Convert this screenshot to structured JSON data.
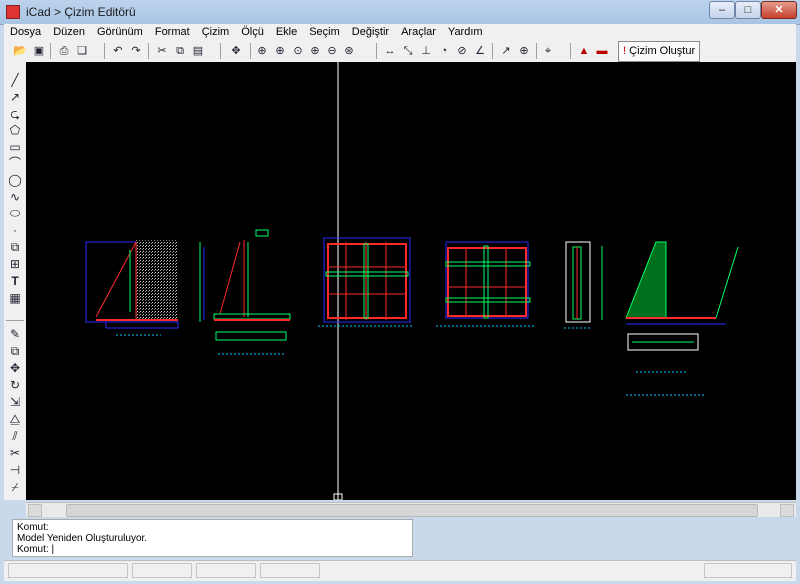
{
  "window": {
    "title": "iCad > Çizim Editörü",
    "min_label": "–",
    "max_label": "□",
    "close_label": "✕"
  },
  "menu": [
    "Dosya",
    "Düzen",
    "Görünüm",
    "Format",
    "Çizim",
    "Ölçü",
    "Ekle",
    "Seçim",
    "Değiştir",
    "Araçlar",
    "Yardım"
  ],
  "toolbar": {
    "cizim_olustur_label": "Çizim Oluştur",
    "icons": [
      "open-icon",
      "save-icon",
      "print-preview-icon",
      "paste-icon",
      "undo-icon",
      "redo-icon",
      "cut-icon",
      "copy-icon",
      "paste-special-icon",
      "pan-icon",
      "zoom-window-icon",
      "zoom-realtime-icon",
      "zoom-extents-icon",
      "zoom-in-icon",
      "zoom-out-icon",
      "zoom-all-icon",
      "dimension-linear-icon",
      "dimension-aligned-icon",
      "dimension-ordinate-icon",
      "dimension-radius-icon",
      "dimension-diameter-icon",
      "dimension-angle-icon",
      "leader-icon",
      "center-mark-icon",
      "snap-icon",
      "layer-icon",
      "hatch-icon"
    ]
  },
  "left_tools": [
    "line-icon",
    "ray-icon",
    "polyline-icon",
    "polygon-icon",
    "rectangle-icon",
    "arc-icon",
    "circle-icon",
    "spline-icon",
    "ellipse-icon",
    "point-icon",
    "block-icon",
    "insert-icon",
    "text-icon",
    "hatch-tool-icon",
    "erase-icon",
    "copy-tool-icon",
    "move-icon",
    "rotate-icon",
    "scale-icon",
    "mirror-icon",
    "offset-icon",
    "trim-icon",
    "extend-icon",
    "break-icon"
  ],
  "command": {
    "line1": "Komut:",
    "line2": " Model Yeniden Oluşturuluyor.",
    "line3": "Komut:  |"
  },
  "colors": {
    "canvas_bg": "#000000",
    "crosshair": "#ffffff"
  }
}
